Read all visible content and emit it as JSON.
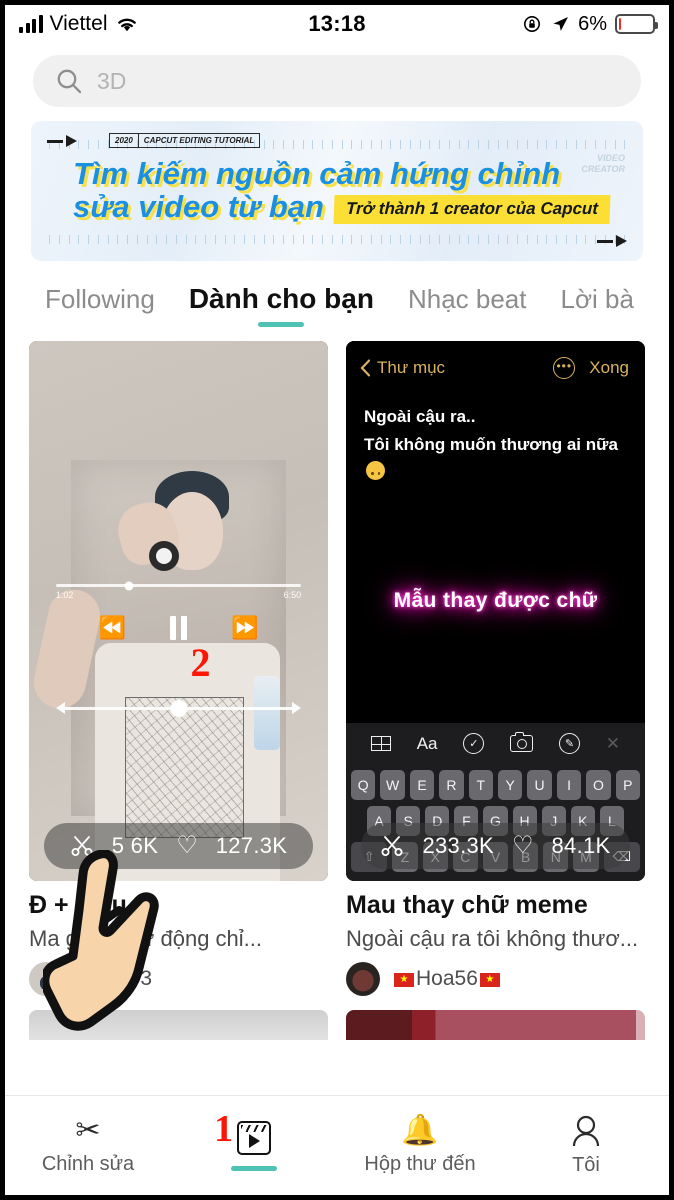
{
  "status_bar": {
    "carrier": "Viettel",
    "time": "13:18",
    "battery_percent": "6%",
    "battery_level": 6,
    "icons": [
      "signal-bars-icon",
      "wifi-icon",
      "rotation-lock-icon",
      "location-arrow-icon",
      "battery-icon"
    ]
  },
  "search": {
    "placeholder": "3D",
    "icon": "search-icon"
  },
  "banner": {
    "tag_year": "2020",
    "tag_label": "CAPCUT EDITING TUTORIAL",
    "headline_line1": "Tìm kiếm nguồn cảm hứng chỉnh",
    "headline_line2": "sửa video từ bạn",
    "pill": "Trở thành 1 creator của Capcut",
    "corner_line1": "VIDEO",
    "corner_line2": "CREATOR",
    "accent_color": "#1b8fe0",
    "pill_color": "#fbdf35"
  },
  "tabs": {
    "active_index": 1,
    "items": [
      {
        "label": "Following"
      },
      {
        "label": "Dành cho bạn"
      },
      {
        "label": "Nhạc beat"
      },
      {
        "label": "Lời bà"
      }
    ],
    "indicator_color": "#4ec3b3"
  },
  "feed": {
    "left_card": {
      "title": "Đ         + màu",
      "subtitle": "Ma      g str + tự động chỉ...",
      "author": "Thta_03",
      "uses": "5    6K",
      "likes": "127.3K",
      "player": {
        "current_time": "1:02",
        "total_time": "6:50",
        "rewind_icon": "rewind-icon",
        "pause_icon": "pause-icon",
        "forward_icon": "fast-forward-icon"
      },
      "annotation": "2"
    },
    "right_card": {
      "title": "Mau thay chữ meme",
      "subtitle": "Ngoài cậu ra tôi không thươ...",
      "author": "Hoa56",
      "uses": "233.3K",
      "likes": "84.1K",
      "editor": {
        "back_label": "Thư mục",
        "done_label": "Xong",
        "text_line1": "Ngoài cậu ra..",
        "text_line2": "Tôi không muốn thương ai nữa",
        "neon_text": "Mẫu thay được chữ",
        "toolbar": [
          "grid-icon",
          "Aa",
          "check-circle-icon",
          "camera-icon",
          "marker-icon",
          "close-icon"
        ],
        "keyboard_rows": [
          [
            "Q",
            "W",
            "E",
            "R",
            "T",
            "Y",
            "U",
            "I",
            "O",
            "P"
          ],
          [
            "A",
            "S",
            "D",
            "F",
            "G",
            "H",
            "J",
            "K",
            "L"
          ],
          [
            "⇧",
            "Z",
            "X",
            "C",
            "V",
            "B",
            "N",
            "M",
            "⌫"
          ]
        ]
      }
    }
  },
  "bottom_nav": {
    "active_index": 1,
    "annotation": "1",
    "items": [
      {
        "label": "Chỉnh sửa",
        "icon": "scissors-icon"
      },
      {
        "label": "",
        "icon": "template-film-icon"
      },
      {
        "label": "Hộp thư đến",
        "icon": "bell-icon"
      },
      {
        "label": "Tôi",
        "icon": "person-icon"
      }
    ],
    "indicator_color": "#4ec3b3"
  }
}
